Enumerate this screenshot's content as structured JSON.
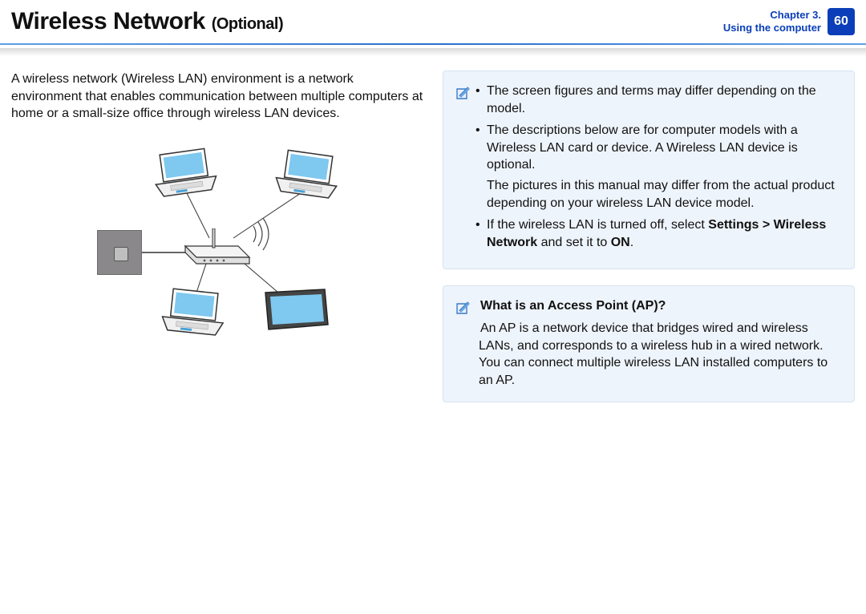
{
  "header": {
    "title_main": "Wireless Network",
    "title_optional": "(Optional)",
    "chapter_line1": "Chapter 3.",
    "chapter_line2": "Using the computer",
    "page_number": "60"
  },
  "left": {
    "intro": "A wireless network (Wireless LAN) environment is a network environment that enables communication between multiple computers at home or a small-size office through wireless LAN devices."
  },
  "right": {
    "note1": {
      "b1": "The screen figures and terms may differ depending on the model.",
      "b2a": "The descriptions below are for computer models with a Wireless LAN card or device. A Wireless LAN device is optional.",
      "b2b": "The pictures in this manual may differ from the actual product depending on your wireless LAN device model.",
      "b3_pre": "If the wireless LAN is turned off, select ",
      "b3_bold1": "Settings > Wireless Network",
      "b3_mid": " and set it to ",
      "b3_bold2": "ON",
      "b3_post": "."
    },
    "note2": {
      "heading": "What is an Access Point (AP)?",
      "body": "An AP is a network device that bridges wired and wireless LANs, and corresponds to a wireless hub in a wired network. You can connect multiple wireless LAN installed computers to an AP."
    }
  }
}
